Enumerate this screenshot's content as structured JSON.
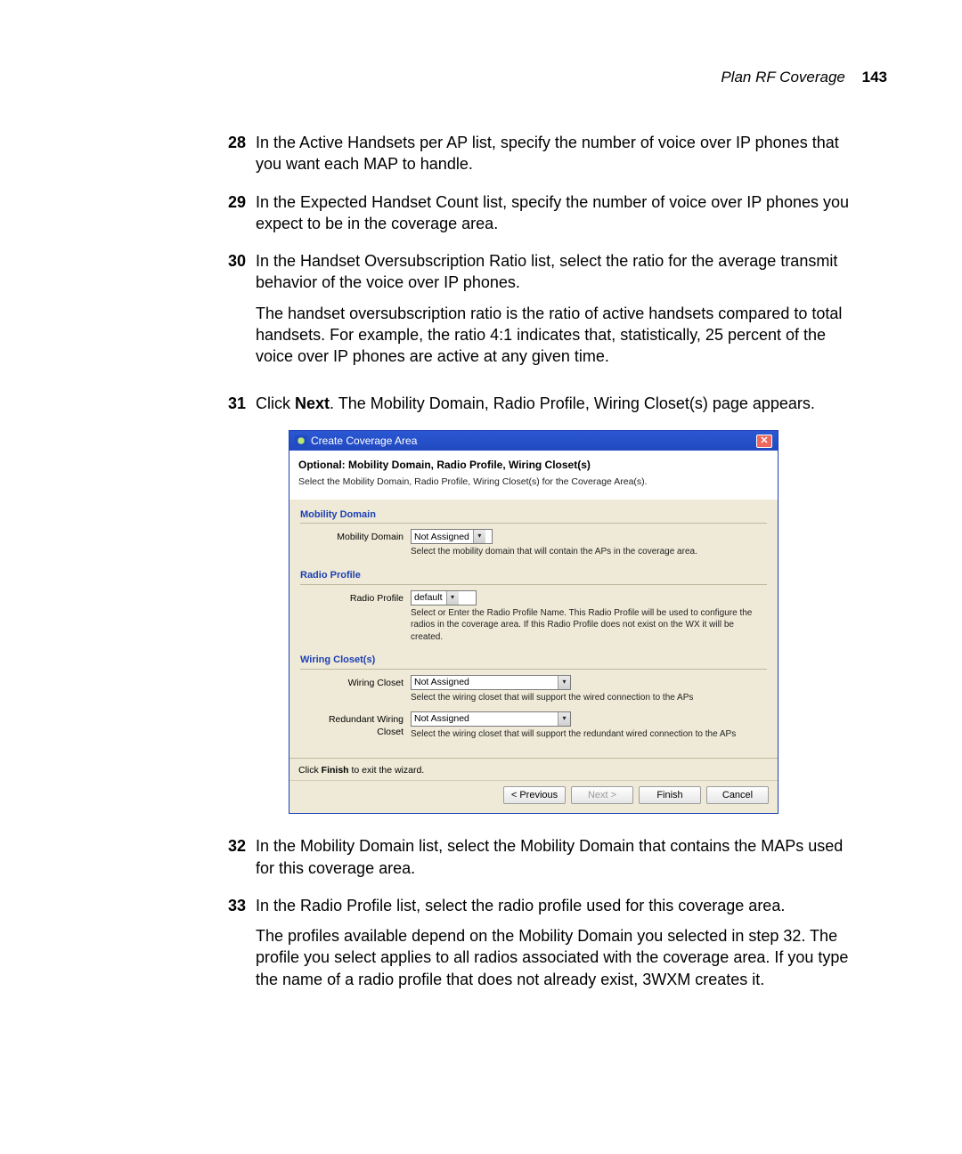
{
  "page_header": {
    "section_title": "Plan RF Coverage",
    "page_number": "143"
  },
  "steps": {
    "s28": {
      "num": "28",
      "text": "In the Active Handsets per AP list, specify the number of voice over IP phones that you want each MAP to handle."
    },
    "s29": {
      "num": "29",
      "text": "In the Expected Handset Count list, specify the number of voice over IP phones you expect to be in the coverage area."
    },
    "s30": {
      "num": "30",
      "text": "In the Handset Oversubscription Ratio list, select the ratio for the average transmit behavior of the voice over IP phones.",
      "extra": "The handset oversubscription ratio is the ratio of active handsets compared to total handsets. For example, the ratio 4:1 indicates that, statistically, 25 percent of the voice over IP phones are active at any given time."
    },
    "s31": {
      "num": "31",
      "pre": "Click ",
      "bold": "Next",
      "post": ". The Mobility Domain, Radio Profile, Wiring Closet(s) page appears."
    },
    "s32": {
      "num": "32",
      "text": "In the Mobility Domain list, select the Mobility Domain that contains the MAPs used for this coverage area."
    },
    "s33": {
      "num": "33",
      "text": "In the Radio Profile list, select the radio profile used for this coverage area.",
      "extra": "The profiles available depend on the Mobility Domain you selected in step 32. The profile you select applies to all radios associated with the coverage area. If you type the name of a radio profile that does not already exist, 3WXM creates it."
    }
  },
  "wizard": {
    "title": "Create Coverage Area",
    "heading": "Optional: Mobility Domain, Radio Profile, Wiring Closet(s)",
    "sub": "Select the Mobility Domain, Radio Profile, Wiring Closet(s) for the Coverage Area(s).",
    "mobility": {
      "legend": "Mobility Domain",
      "label": "Mobility Domain",
      "value": "Not Assigned",
      "hint": "Select the mobility domain that will contain  the APs in the coverage area."
    },
    "radio": {
      "legend": "Radio Profile",
      "label": "Radio Profile",
      "value": "default",
      "hint": "Select or Enter the Radio Profile Name. This Radio Profile will be used to configure the radios in the coverage area. If this Radio Profile does not exist on the WX it will be created."
    },
    "wiring": {
      "legend": "Wiring Closet(s)",
      "label1": "Wiring Closet",
      "value1": "Not Assigned",
      "hint1": "Select the wiring closet that will support the wired connection to the APs",
      "label2": "Redundant Wiring Closet",
      "value2": "Not Assigned",
      "hint2": "Select the wiring closet that will support the redundant wired connection to the APs"
    },
    "footnote_pre": "Click ",
    "footnote_bold": "Finish",
    "footnote_post": " to exit the wizard.",
    "buttons": {
      "previous": "< Previous",
      "next": "Next >",
      "finish": "Finish",
      "cancel": "Cancel"
    }
  }
}
